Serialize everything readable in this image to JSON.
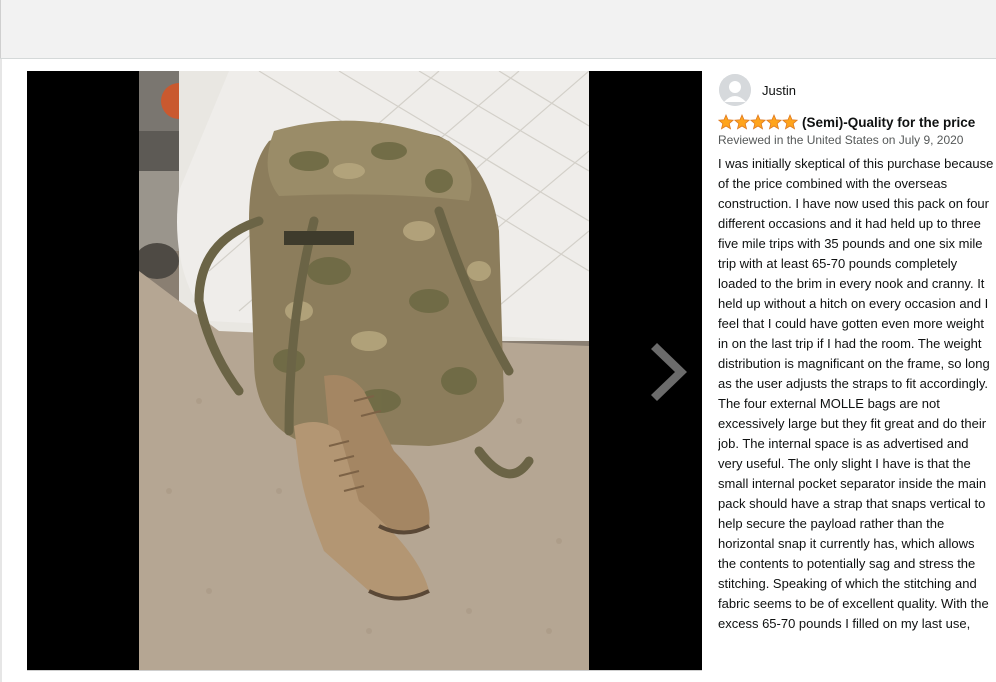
{
  "review": {
    "reviewer_name": "Justin",
    "rating": 5,
    "max_rating": 5,
    "title": "(Semi)-Quality for the price",
    "date_line": "Reviewed in the United States on July 9, 2020",
    "body": "I was initially skeptical of this purchase because of the price combined with the overseas construction. I have now used this pack on four different occasions and it had held up to three five mile trips with 35 pounds and one six mile trip with at least 65-70 pounds completely loaded to the brim in every nook and cranny. It held up without a hitch on every occasion and I feel that I could have gotten even more weight in on the last trip if I had the room. The weight distribution is magnificant on the frame, so long as the user adjusts the straps to fit accordingly. The four external MOLLE bags are not excessively large but they fit great and do their job. The internal space is as advertised and very useful. The only slight I have is that the small internal pocket separator inside the main pack should have a strap that snaps vertical to help secure the payload rather than the horizontal snap it currently has, which allows the contents to potentially sag and stress the stitching. Speaking of which the stitching and fabric seems to be of excellent quality. With the excess 65-70 pounds I filled on my last use,"
  },
  "viewer": {
    "next_icon": "chevron-right-icon"
  },
  "colors": {
    "star": "#ffa41c",
    "star_outline": "#de7921",
    "arrow": "#6b6b6b",
    "viewer_bg": "#000000"
  }
}
